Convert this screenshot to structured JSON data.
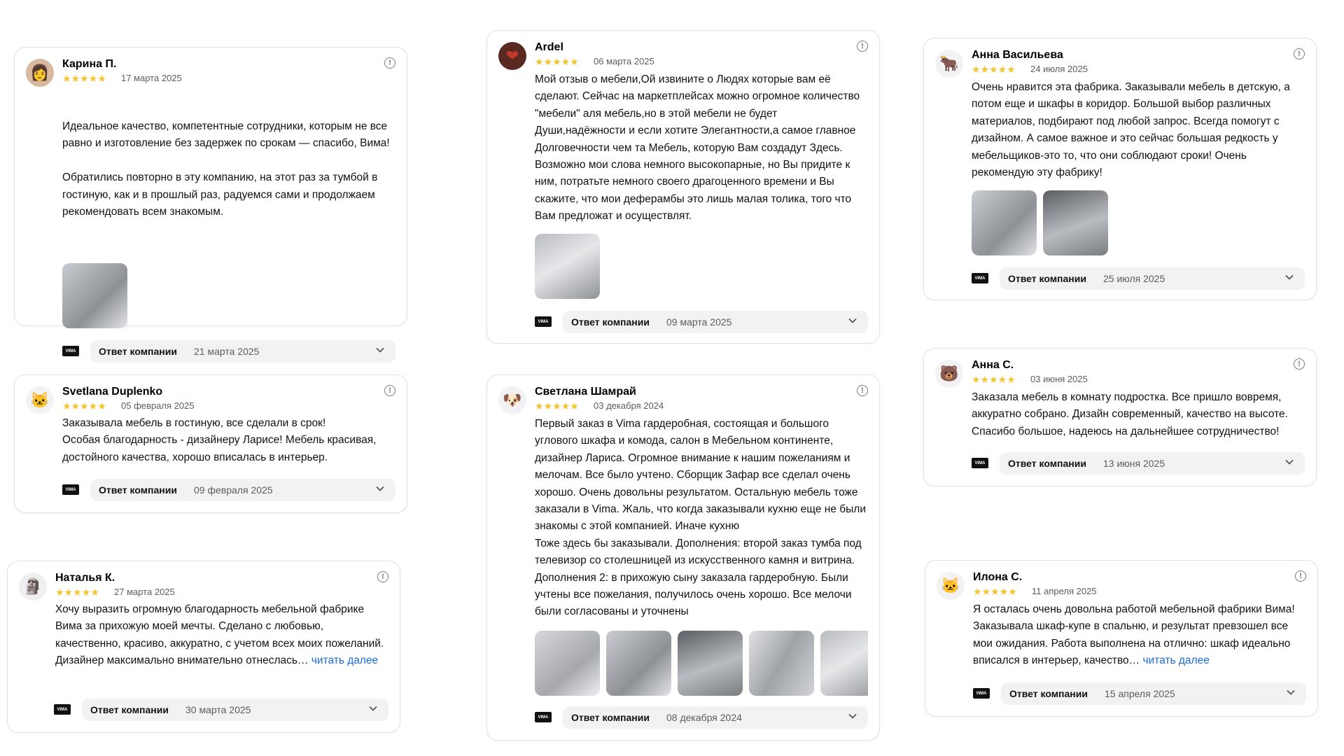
{
  "reply_label": "Ответ компании",
  "reply_logo_text": "VIMA",
  "star_glyphs": "★★★★★",
  "read_more": "читать далее",
  "reviews": [
    {
      "author": "Карина П.",
      "rating": 5,
      "date": "17 марта 2025",
      "avatar_icon": "user-photo",
      "text": "Идеальное качество, компетентные сотрудники, которым не все равно и изготовление без задержек по срокам — спасибо, Вима!\n\nОбратились повторно в эту компанию, на этот раз за тумбой в гостиную, как и в прошлый раз, радуемся сами и продолжаем рекомендовать всем знакомым.",
      "photo_count": 1,
      "reply_date": "21 марта 2025"
    },
    {
      "author": "Svetlana Duplenko",
      "rating": 5,
      "date": "05 февраля 2025",
      "avatar_icon": "cat-face",
      "text": "Заказывала мебель в гостиную, все сделали в срок!\nОсобая благодарность - дизайнеру Ларисе! Мебель красивая, достойного качества, хорошо вписалась в интерьер.",
      "photo_count": 0,
      "reply_date": "09 февраля 2025"
    },
    {
      "author": "Наталья К.",
      "rating": 5,
      "date": "27 марта 2025",
      "avatar_icon": "moai",
      "text": "Хочу выразить огромную благодарность мебельной фабрике Вима за прихожую моей мечты. Сделано с любовью, качественно, красиво, аккуратно, с учетом всех моих пожеланий. Дизайнер максимально внимательно отнеслась…",
      "truncated": true,
      "photo_count": 0,
      "reply_date": "30 марта 2025"
    },
    {
      "author": "Ardel",
      "rating": 5,
      "date": "06 марта 2025",
      "avatar_icon": "heart",
      "text": "Мой отзыв о мебели,Ой извините о Людях которые вам её сделают. Сейчас на маркетплейсах можно огромное количество \"мебели\" аля мебель,но в этой мебели не будет Души,надёжности и если хотите Элегантности,а самое главное Долговечности чем та Мебель, которую Вам создадут Здесь. Возможно мои слова немного высокопарные, но Вы придите к ним, потратьте немного своего драгоценного времени и Вы скажите, что мои деферамбы это лишь малая толика, того что Вам предложат и осуществлят.",
      "photo_count": 1,
      "reply_date": "09 марта 2025"
    },
    {
      "author": "Светлана Шамрай",
      "rating": 5,
      "date": "03 декабря 2024",
      "avatar_icon": "dog-face",
      "text": "Первый заказ в Vima гардеробная, состоящая и большого углового шкафа и комода, салон в Мебельном континенте, дизайнер Лариса. Огромное внимание к нашим пожеланиям и мелочам. Все было учтено. Сборщик Зафар все сделал очень хорошо. Очень довольны результатом. Остальную мебель тоже заказали в Vima. Жаль, что когда заказывали кухню еще не были знакомы с этой компанией. Иначе кухню\nТоже здесь бы заказывали. Дополнения: второй заказ тумба под телевизор со столешницей из искусственного камня и витрина. Дополнения 2: в прихожую сыну заказала гардеробную. Были учтены все пожелания, получилось очень хорошо. Все мелочи были согласованы и уточнены",
      "photo_count": 5,
      "reply_date": "08 декабря 2024"
    },
    {
      "author": "Анна Васильева",
      "rating": 5,
      "date": "24 июля 2025",
      "avatar_icon": "ox",
      "text": "Очень нравится эта фабрика. Заказывали мебель в детскую, а потом еще и шкафы в коридор. Большой выбор различных материалов, подбирают под любой запрос. Всегда помогут с дизайном. А самое важное и это сейчас большая редкость у мебельщиков-это то, что они соблюдают сроки! Очень рекомендую эту фабрику!",
      "photo_count": 2,
      "reply_date": "25 июля 2025"
    },
    {
      "author": "Анна С.",
      "rating": 5,
      "date": "03 июня 2025",
      "avatar_icon": "bear-face",
      "text": "Заказала мебель в комнату подростка. Все пришло вовремя, аккуратно собрано. Дизайн современный, качество на высоте. Спасибо большое, надеюсь на дальнейшее сотрудничество!",
      "photo_count": 0,
      "reply_date": "13 июня 2025"
    },
    {
      "author": "Илона С.",
      "rating": 5,
      "date": "11 апреля 2025",
      "avatar_icon": "cat-face",
      "text": "Я осталась очень довольна работой мебельной фабрики Вима! Заказывала шкаф-купе в спальню, и результат превзошел все мои ожидания. Работа выполнена на отлично: шкаф идеально вписался в интерьер, качество…",
      "truncated": true,
      "photo_count": 0,
      "reply_date": "15 апреля 2025"
    }
  ]
}
